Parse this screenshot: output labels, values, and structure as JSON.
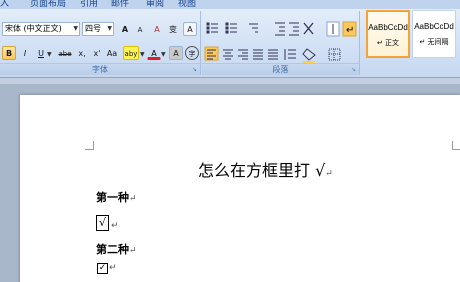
{
  "tabs": [
    "入",
    "页面布局",
    "引用",
    "邮件",
    "审阅",
    "视图"
  ],
  "font_group": {
    "font_name": "宋体 (中文正文)",
    "font_size": "四号",
    "label": "字体",
    "buttons": {
      "grow": "A",
      "shrink": "A",
      "clear": "A",
      "phonetic": "变",
      "border": "A",
      "bold": "B",
      "italic": "I",
      "underline": "U",
      "strike": "abe",
      "subscript": "x,",
      "superscript": "x'",
      "case": "Aa",
      "highlight": "aby",
      "color": "A",
      "shade": "A",
      "enclose": "字"
    }
  },
  "paragraph_group": {
    "label": "段落"
  },
  "styles": [
    {
      "sample": "AaBbCcDd",
      "name": "↵ 正文"
    },
    {
      "sample": "AaBbCcDd",
      "name": "↵ 无间隔"
    }
  ],
  "document": {
    "title": "怎么在方框里打 √",
    "para_mark": "↵",
    "heading1": "第一种",
    "box1_symbol": "√",
    "heading2": "第二种",
    "box2_symbol": "✓"
  },
  "colors": {
    "ribbon_top": "#e4edf9",
    "highlight": "#fbc85c",
    "page": "#ffffff",
    "workspace": "#a9b7ca"
  }
}
